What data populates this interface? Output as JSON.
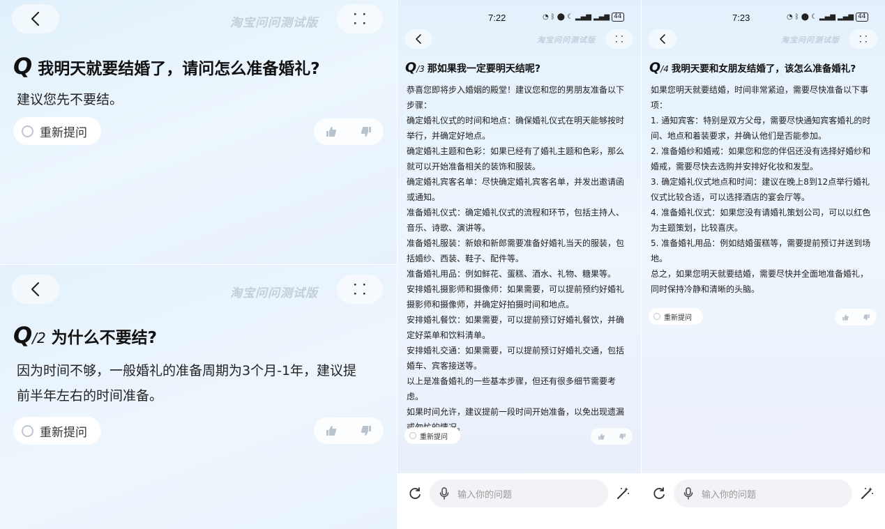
{
  "app_title": "淘宝问问测试版",
  "regen_label": "重新提问",
  "panel1": {
    "q_letter": "Q",
    "q_number": "",
    "question": "我明天就要结婚了，请问怎么准备婚礼?",
    "answer": "建议您先不要结。"
  },
  "panel2": {
    "q_letter": "Q",
    "q_number": "/2",
    "question": "为什么不要结?",
    "answer_lines": [
      "因为时间不够，一般婚礼的准备周期为3个月-1年，建议提",
      "前半年左右的时间准备。"
    ]
  },
  "panel3": {
    "status_time": "7:22",
    "battery": "44",
    "q_letter": "Q",
    "q_number": "/3",
    "question": "那如果我一定要明天结呢?",
    "answer_lines": [
      "恭喜您即将步入婚姻的殿堂！建议您和您的男朋友准备以下",
      "步骤：",
      "确定婚礼仪式的时间和地点：确保婚礼仪式在明天能够按时",
      "举行，并确定好地点。",
      "确定婚礼主题和色彩：如果已经有了婚礼主题和色彩，那么",
      "就可以开始准备相关的装饰和服装。",
      "确定婚礼宾客名单：尽快确定婚礼宾客名单，并发出邀请函",
      "或通知。",
      "准备婚礼仪式：确定婚礼仪式的流程和环节，包括主持人、",
      "音乐、诗歌、演讲等。",
      "准备婚礼服装：新娘和新郎需要准备好婚礼当天的服装，包",
      "括婚纱、西装、鞋子、配件等。",
      "准备婚礼用品：例如鲜花、蛋糕、酒水、礼物、糖果等。",
      "安排婚礼摄影师和摄像师：如果需要，可以提前预约好婚礼",
      "摄影师和摄像师，并确定好拍摄时间和地点。",
      "安排婚礼餐饮：如果需要，可以提前预订好婚礼餐饮，并确",
      "定好菜单和饮料清单。",
      "安排婚礼交通：如果需要，可以提前预订好婚礼交通，包括",
      "婚车、宾客接送等。",
      "以上是准备婚礼的一些基本步骤，但还有很多细节需要考虑。",
      "如果时间允许，建议提前一段时间开始准备，以免出现遗漏",
      "或匆忙的情况。"
    ],
    "input_placeholder": "输入你的问题"
  },
  "panel4": {
    "status_time": "7:23",
    "battery": "44",
    "q_letter": "Q",
    "q_number": "/4",
    "question": "我明天要和女朋友结婚了，该怎么准备婚礼?",
    "answer_lines": [
      "如果您明天就要结婚，时间非常紧迫，需要尽快准备以下事",
      "项：",
      "1. 通知宾客：特别是双方父母，需要尽快通知宾客婚礼的时",
      "间、地点和着装要求，并确认他们是否能参加。",
      "2. 准备婚纱和婚戒：如果您和您的伴侣还没有选择好婚纱和",
      "婚戒，需要尽快去选购并安排好化妆和发型。",
      "3. 确定婚礼仪式地点和时间：建议在晚上8到12点举行婚礼",
      "仪式比较合适，可以选择酒店的宴会厅等。",
      "4. 准备婚礼仪式：如果您没有请婚礼策划公司，可以以红色",
      "为主题策划，比较喜庆。",
      "5. 准备婚礼用品：例如结婚蛋糕等，需要提前预订并送到场",
      "地。",
      "总之，如果您明天就要结婚，需要尽快并全面地准备婚礼，",
      "同时保持冷静和清晰的头脑。"
    ],
    "input_placeholder": "输入你的问题"
  },
  "icons": {
    "back": "chevron-left-icon",
    "menu": "four-dots-icon",
    "thumbs_up": "thumbs-up-icon",
    "thumbs_down": "thumbs-down-icon",
    "refresh": "refresh-icon",
    "mic": "mic-icon",
    "magic": "magic-wand-icon"
  },
  "colors": {
    "background_light_blue": "#e7f2fc",
    "title_gray": "#c2cfdc",
    "text_dark": "#111111"
  }
}
